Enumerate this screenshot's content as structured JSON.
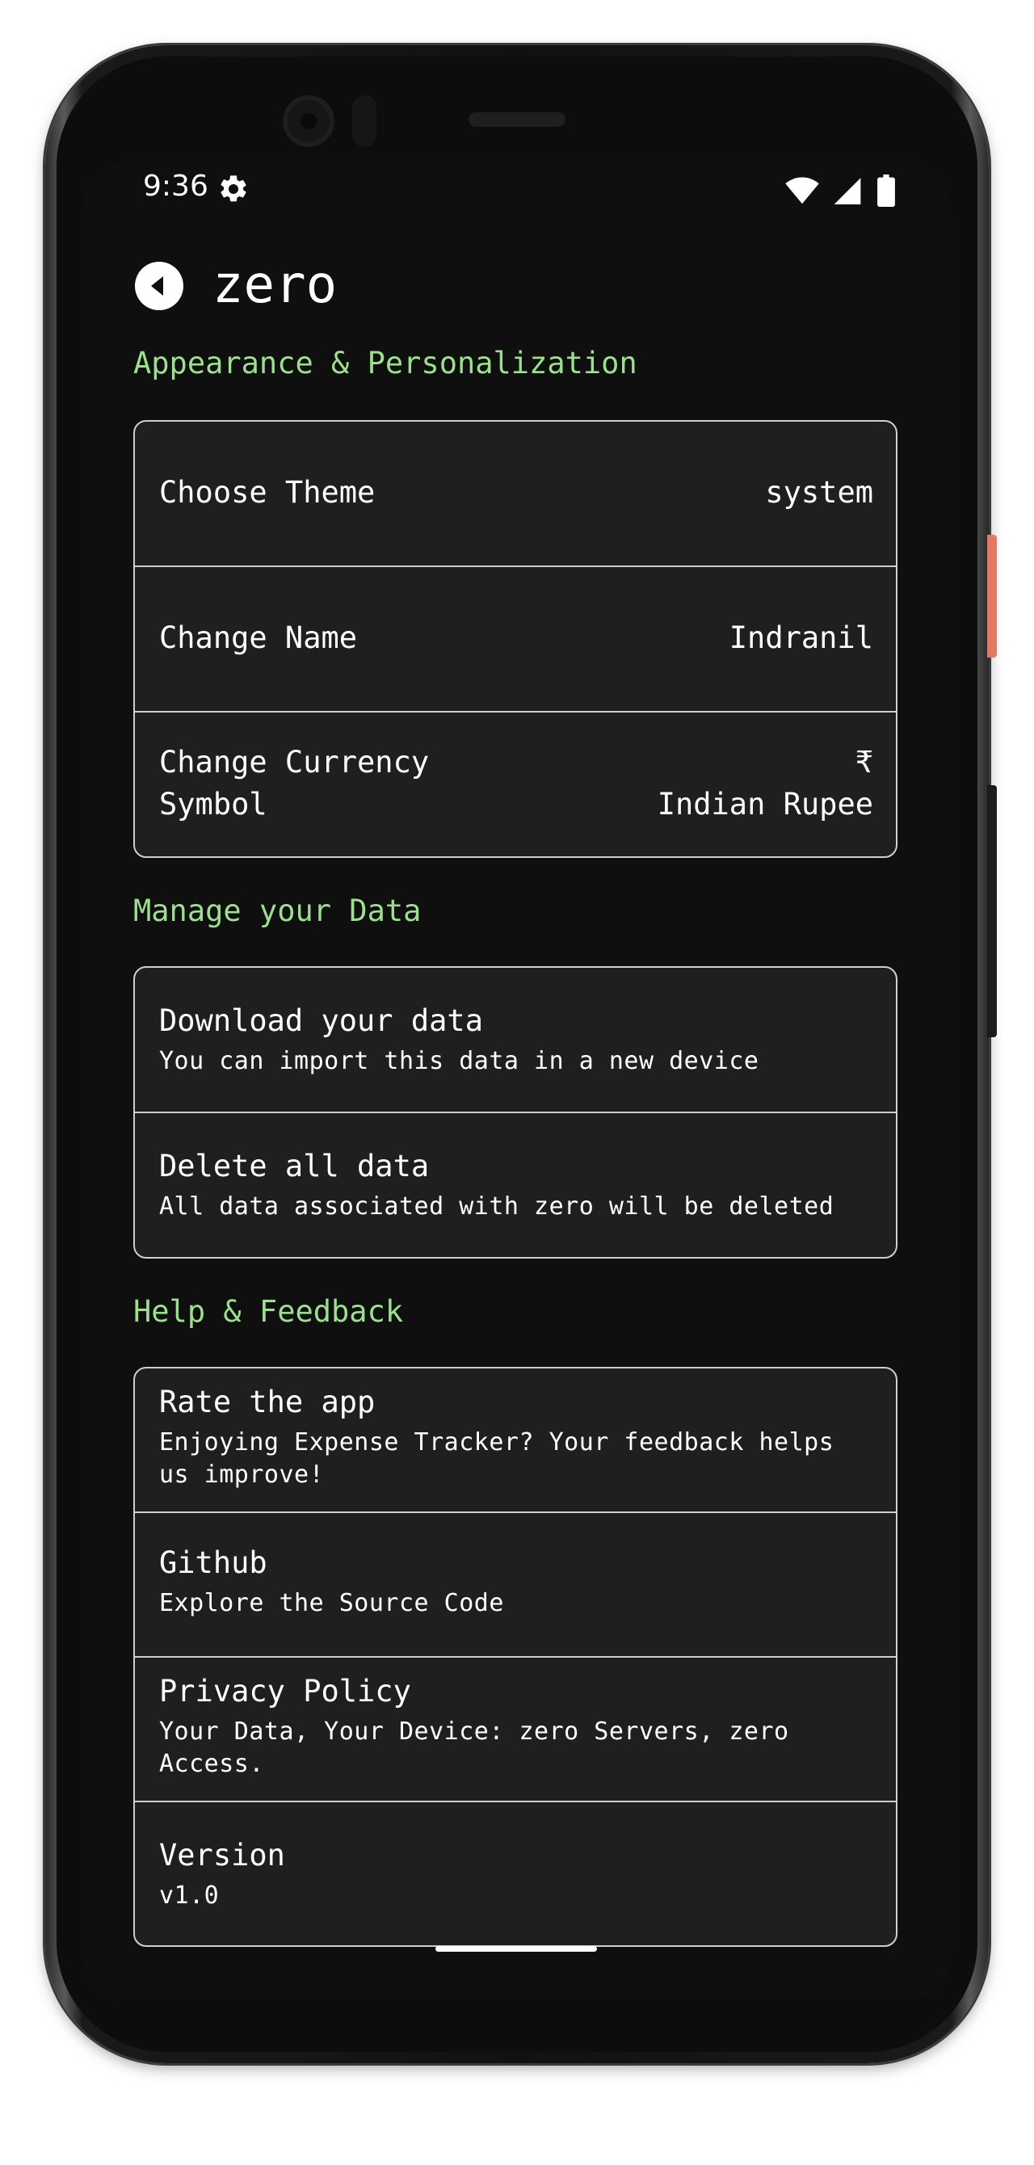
{
  "status": {
    "time": "9:36"
  },
  "header": {
    "title": "zero"
  },
  "sections": {
    "appearance": {
      "title": "Appearance & Personalization",
      "theme": {
        "label": "Choose Theme",
        "value": "system"
      },
      "name": {
        "label": "Change Name",
        "value": "Indranil"
      },
      "currency": {
        "label_line1": "Change Currency",
        "label_line2": "Symbol",
        "value_symbol": "₹",
        "value_name": "Indian Rupee"
      }
    },
    "data": {
      "title": "Manage your Data",
      "download": {
        "label": "Download your data",
        "sub": "You can import this data in a new device"
      },
      "delete": {
        "label": "Delete all data",
        "sub": "All data associated with zero will be deleted"
      }
    },
    "help": {
      "title": "Help & Feedback",
      "rate": {
        "label": "Rate the app",
        "sub_line1": "Enjoying Expense Tracker? Your feedback helps",
        "sub_line2": "us improve!"
      },
      "github": {
        "label": "Github",
        "sub": "Explore the Source Code"
      },
      "privacy": {
        "label": "Privacy Policy",
        "sub_line1": "Your Data, Your Device: zero Servers, zero",
        "sub_line2": "Access."
      },
      "version": {
        "label": "Version",
        "sub": "v1.0"
      }
    }
  },
  "colors": {
    "accent": "#9be08c",
    "background": "#0f0f0f",
    "card": "#1f1f1f",
    "border": "#cfcfcf"
  },
  "icons": [
    "gear-icon",
    "wifi-icon",
    "signal-icon",
    "battery-icon",
    "back-arrow-icon"
  ]
}
